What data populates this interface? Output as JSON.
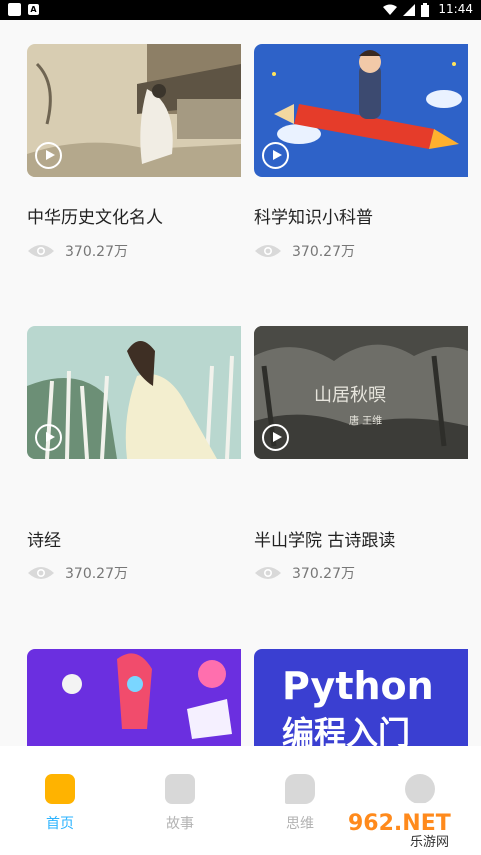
{
  "status_bar": {
    "time": "11:44"
  },
  "cards": [
    {
      "title": "中华历史文化名人",
      "views": "370.27万"
    },
    {
      "title": "科学知识小科普",
      "views": "370.27万"
    },
    {
      "title": "诗经",
      "views": "370.27万"
    },
    {
      "title": "半山学院 古诗跟读",
      "views": "370.27万"
    },
    {
      "title": "",
      "views": ""
    },
    {
      "title": "",
      "views": ""
    }
  ],
  "thumb_text": {
    "poem_title": "山居秋暝",
    "poem_author": "唐  王维",
    "python_title": "Python",
    "python_sub": "编程入门"
  },
  "bottom_nav": [
    {
      "label": "首页",
      "active": true
    },
    {
      "label": "故事",
      "active": false
    },
    {
      "label": "思维",
      "active": false
    },
    {
      "label": "",
      "active": false
    }
  ],
  "watermark": {
    "brand": "962.NET",
    "sub": "乐游网"
  },
  "colors": {
    "accent": "#2bb3ff",
    "inactive": "#b3b3b3"
  }
}
